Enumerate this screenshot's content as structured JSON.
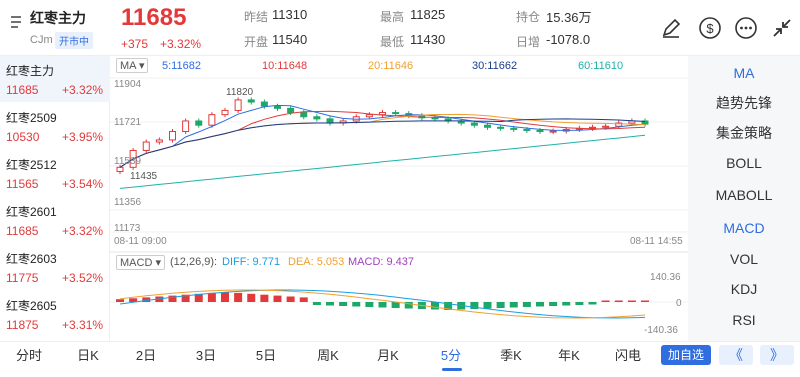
{
  "header": {
    "back_icon": "back-chevron-icon",
    "name": "红枣主力",
    "code": "CJm",
    "market_status": "开市中",
    "price": "11685",
    "change": "+375",
    "change_pct": "+3.32%",
    "fields": [
      {
        "label": "昨结",
        "value": "11310"
      },
      {
        "label": "开盘",
        "value": "11540"
      },
      {
        "label": "最高",
        "value": "11825"
      },
      {
        "label": "最低",
        "value": "11430"
      },
      {
        "label": "持仓",
        "value": "15.36万"
      },
      {
        "label": "日增",
        "value": "-1078.0"
      }
    ],
    "icons": [
      "edit-pen-icon",
      "dollar-circle-icon",
      "more-options-icon",
      "collapse-arrows-icon"
    ]
  },
  "sidebar": {
    "items": [
      {
        "name": "红枣主力",
        "price": "11685",
        "pct": "+3.32%"
      },
      {
        "name": "红枣2509",
        "price": "10530",
        "pct": "+3.95%"
      },
      {
        "name": "红枣2512",
        "price": "11565",
        "pct": "+3.54%"
      },
      {
        "name": "红枣2601",
        "price": "11685",
        "pct": "+3.32%"
      },
      {
        "name": "红枣2603",
        "price": "11775",
        "pct": "+3.52%"
      },
      {
        "name": "红枣2605",
        "price": "11875",
        "pct": "+3.31%"
      }
    ]
  },
  "chart": {
    "ma_tag": "MA ▾",
    "ma_values": [
      {
        "label": "5:11682",
        "color": "#2f6de1"
      },
      {
        "label": "10:11648",
        "color": "#e23a3a"
      },
      {
        "label": "20:11646",
        "color": "#f0a030"
      },
      {
        "label": "30:11662",
        "color": "#1a3d8f"
      },
      {
        "label": "60:11610",
        "color": "#20b2aa"
      }
    ],
    "y_labels": [
      "11904",
      "11721",
      "11539",
      "11356",
      "11173"
    ],
    "high_mark": "11820",
    "low_mark": "11435",
    "time_start": "08-11 09:00",
    "time_end": "08-11 14:55",
    "macd_tag": "MACD ▾",
    "macd_params": "(12,26,9):",
    "macd_values": [
      {
        "label": "DIFF: 9.771",
        "color": "#1a9ee0"
      },
      {
        "label": "DEA: 5.053",
        "color": "#f0a030"
      },
      {
        "label": "MACD: 9.437",
        "color": "#a040c0"
      }
    ],
    "macd_y": [
      "140.36",
      "0",
      "-140.36"
    ]
  },
  "chart_data": {
    "type": "candlestick",
    "title": "红枣主力 5分",
    "x_range": [
      "08-11 09:00",
      "08-11 14:55"
    ],
    "ylim": [
      11173,
      11904
    ],
    "high": 11820,
    "low": 11435,
    "close": 11685,
    "moving_averages": [
      {
        "name": "MA5",
        "value": 11682
      },
      {
        "name": "MA10",
        "value": 11648
      },
      {
        "name": "MA20",
        "value": 11646
      },
      {
        "name": "MA30",
        "value": 11662
      },
      {
        "name": "MA60",
        "value": 11610
      }
    ],
    "macd": {
      "diff": 9.771,
      "dea": 5.053,
      "macd": 9.437,
      "ylim": [
        -140.36,
        140.36
      ]
    }
  },
  "right_panel": {
    "items": [
      "MA",
      "趋势先锋",
      "集金策略",
      "BOLL",
      "MABOLL",
      "MACD",
      "VOL",
      "KDJ",
      "RSI"
    ]
  },
  "bottom": {
    "tabs": [
      "分时",
      "日K",
      "2日",
      "3日",
      "5日",
      "周K",
      "月K",
      "5分",
      "季K",
      "年K",
      "闪电"
    ],
    "active_tab": "5分",
    "add_button": "加自选",
    "prev": "《",
    "next": "》"
  },
  "colors": {
    "up": "#e23a3a",
    "down": "#1ea868",
    "accent": "#2f6de1"
  }
}
